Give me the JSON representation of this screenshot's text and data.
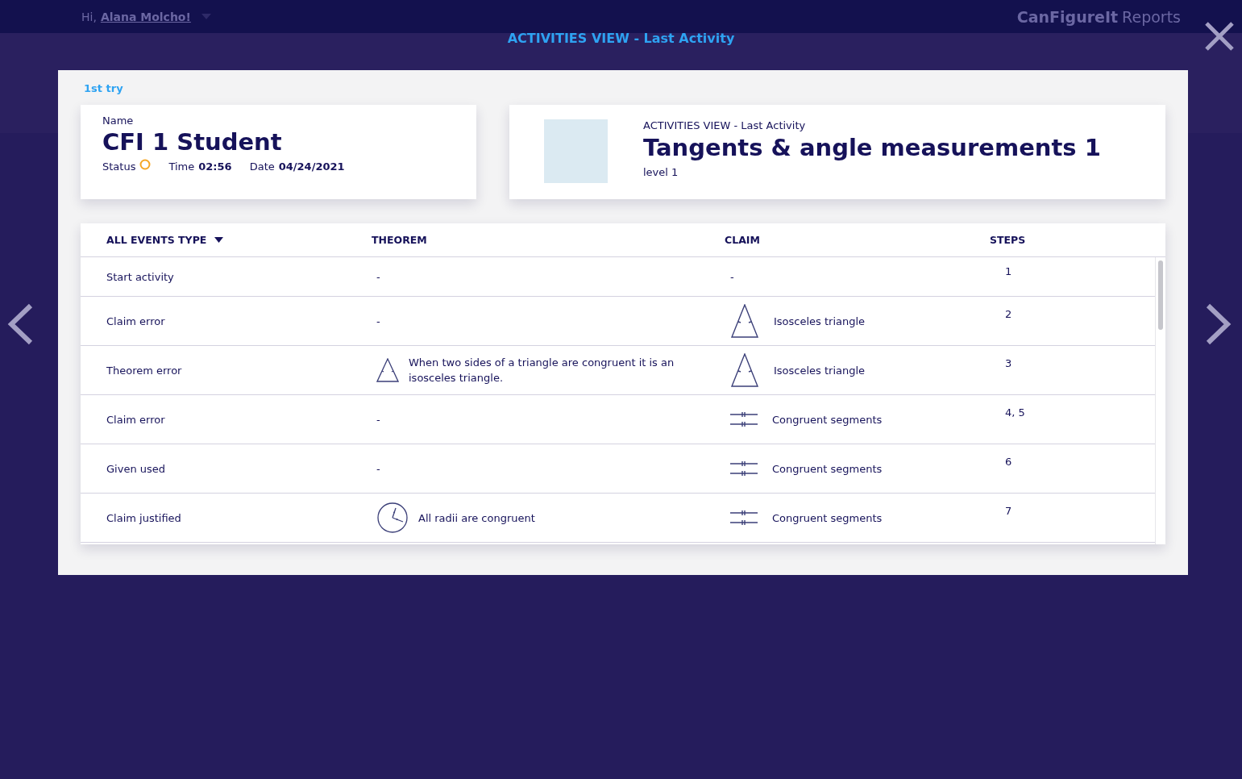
{
  "top_bar": {
    "greeting": "Hi,",
    "user": "Alana Molcho!",
    "brand_bold": "CanFigureIt",
    "brand_light": "Reports"
  },
  "modal": {
    "title": "ACTIVITIES VIEW - Last Activity",
    "attempt": "1st try",
    "student_card": {
      "name_label": "Name",
      "name": "CFI 1 Student",
      "status_label": "Status",
      "time_label": "Time",
      "time": "02:56",
      "date_label": "Date",
      "date": "04/24/2021"
    },
    "activity_card": {
      "overline": "ACTIVITIES VIEW - Last Activity",
      "title": "Tangents & angle measurements 1",
      "level": "level 1"
    },
    "table": {
      "columns": [
        "ALL EVENTS TYPE",
        "THEOREM",
        "CLAIM",
        "STEPS"
      ],
      "rows": [
        {
          "event": "Start activity",
          "theorem": {
            "text": "-"
          },
          "claim": {
            "text": "-"
          },
          "steps": "1"
        },
        {
          "event": "Claim error",
          "theorem": {
            "text": "-"
          },
          "claim": {
            "kind": "triangle",
            "text": "Isosceles triangle"
          },
          "steps": "2"
        },
        {
          "event": "Theorem error",
          "theorem": {
            "kind": "triangle",
            "text": "When two sides of a triangle are congruent it is an isosceles triangle."
          },
          "claim": {
            "kind": "triangle",
            "text": "Isosceles triangle"
          },
          "steps": "3"
        },
        {
          "event": "Claim error",
          "theorem": {
            "text": "-"
          },
          "claim": {
            "kind": "segments",
            "text": "Congruent segments"
          },
          "steps": "4, 5"
        },
        {
          "event": "Given used",
          "theorem": {
            "text": "-"
          },
          "claim": {
            "kind": "segments",
            "text": "Congruent segments"
          },
          "steps": "6"
        },
        {
          "event": "Claim justified",
          "theorem": {
            "kind": "circle",
            "text": "All radii are congruent"
          },
          "claim": {
            "kind": "segments",
            "text": "Congruent segments"
          },
          "steps": "7"
        }
      ]
    }
  }
}
